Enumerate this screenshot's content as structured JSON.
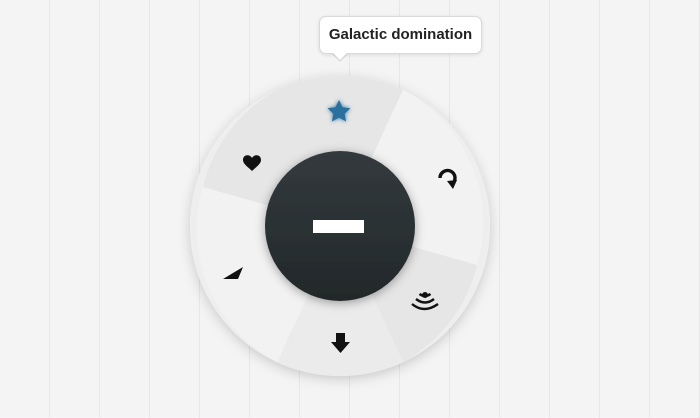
{
  "tooltip": {
    "text": "Galactic domination"
  },
  "menu": {
    "items": [
      {
        "icon": "star-icon",
        "active": true
      },
      {
        "icon": "refresh-icon",
        "active": false
      },
      {
        "icon": "wifi-signal-icon",
        "active": false
      },
      {
        "icon": "download-arrow-icon",
        "active": false
      },
      {
        "icon": "navigation-arrow-icon",
        "active": false
      },
      {
        "icon": "heart-icon",
        "active": false
      }
    ],
    "center_button": {
      "icon": "minus-icon"
    }
  },
  "colors": {
    "accent": "#2c6f9e",
    "hub": "#2b3133",
    "segment_light": "#f2f2f2",
    "segment_dark": "#e6e6e6"
  }
}
